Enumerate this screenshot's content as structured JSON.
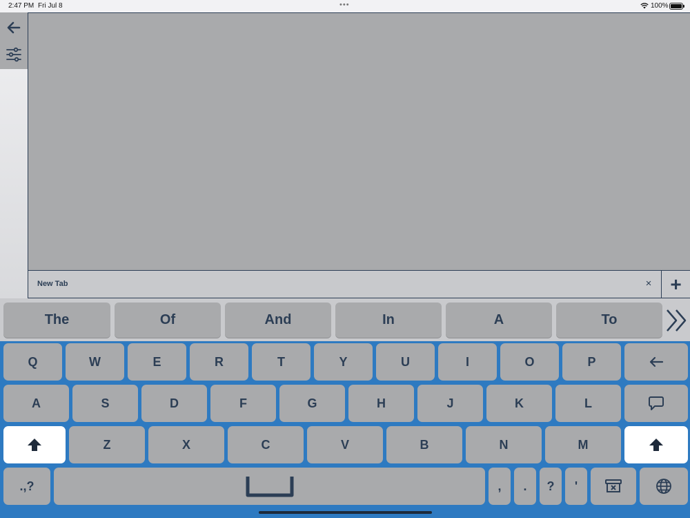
{
  "status_bar": {
    "time": "2:47 PM",
    "date": "Fri Jul 8",
    "multitask_dots": "•••",
    "battery": "100%"
  },
  "sidebar": {
    "back_icon": "arrow-left-icon",
    "settings_icon": "sliders-icon"
  },
  "tab_bar": {
    "tab_title": "New Tab",
    "close_label": "×",
    "add_label": "+"
  },
  "predictions": {
    "words": [
      "The",
      "Of",
      "And",
      "In",
      "A",
      "To"
    ],
    "more_icon": "double-chevron-right-icon"
  },
  "keyboard": {
    "row1": [
      "Q",
      "W",
      "E",
      "R",
      "T",
      "Y",
      "U",
      "I",
      "O",
      "P"
    ],
    "row2": [
      "A",
      "S",
      "D",
      "F",
      "G",
      "H",
      "J",
      "K",
      "L"
    ],
    "row3": [
      "Z",
      "X",
      "C",
      "V",
      "B",
      "N",
      "M"
    ],
    "punct_toggle": ".,?",
    "punctuation": [
      ",",
      ".",
      "?",
      "'"
    ],
    "icons": {
      "backspace": "arrow-left-icon",
      "speak": "speech-bubble-icon",
      "shift": "shift-arrow-icon",
      "space": "space-bar-icon",
      "clear": "clear-text-icon",
      "globe": "globe-icon"
    }
  },
  "colors": {
    "accent": "#2e7ac1",
    "text": "#2c3e55",
    "key": "#a9aaac",
    "shift_key": "#ffffff"
  }
}
